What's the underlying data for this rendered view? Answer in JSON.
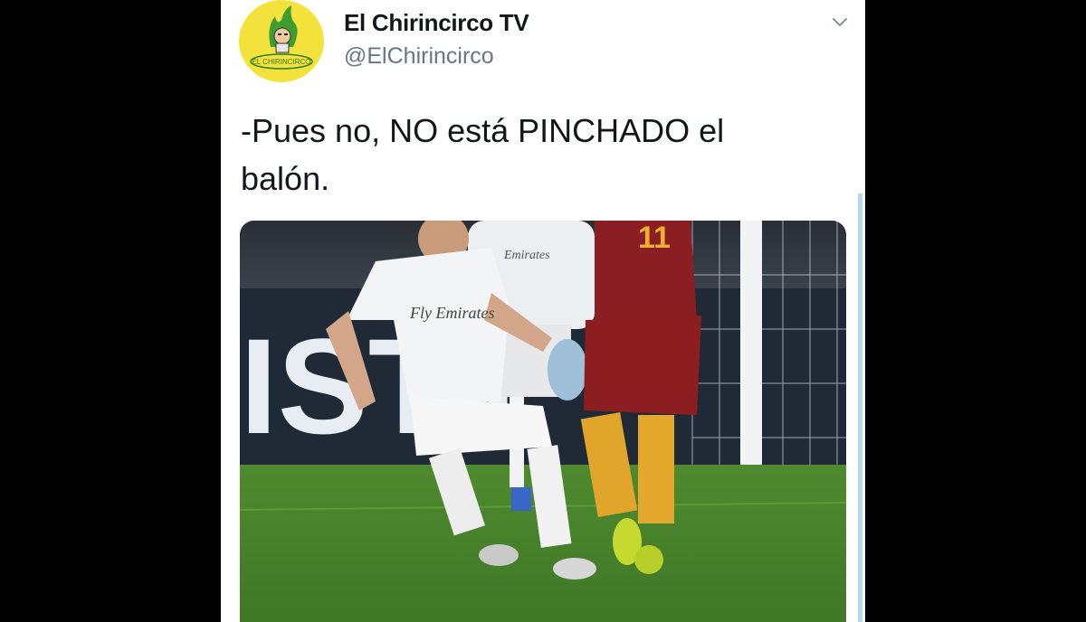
{
  "tweet": {
    "display_name": "El Chirincirco TV",
    "handle": "@ElChirincirco",
    "avatar_text": "EL CHIRINCIRCO",
    "text_line1": "-Pues no, NO está PINCHADO el",
    "text_line2": "balón."
  },
  "media": {
    "board_text": "ISTa",
    "shirt_sponsor": "Fly Emirates",
    "kit_number": "11"
  },
  "icons": {
    "menu": "chevron-down-icon"
  }
}
